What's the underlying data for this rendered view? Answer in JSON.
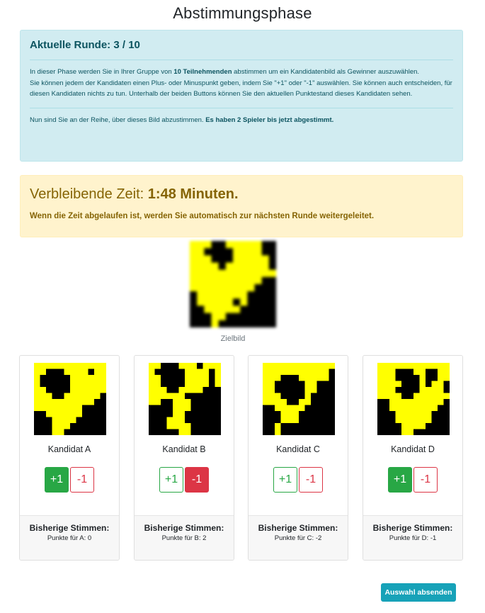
{
  "page": {
    "title": "Abstimmungsphase"
  },
  "info": {
    "round_label": "Aktuelle Runde: 3 / 10",
    "p1_pre": "In dieser Phase werden Sie in Ihrer Gruppe von ",
    "p1_bold": "10 Teilnehmenden",
    "p1_post": " abstimmen um ein Kandidatenbild als Gewinner auszuwählen.",
    "p2": "Sie können jedem der Kandidaten einen Plus- oder Minuspunkt geben, indem Sie \"+1\" oder \"-1\" auswählen. Sie können auch entscheiden, für diesen Kandidaten nichts zu tun. Unterhalb der beiden Buttons können Sie den aktuellen Punktestand dieses Kandidaten sehen.",
    "turn_text": "Nun sind Sie an der Reihe, über dieses Bild abzustimmen. ",
    "turn_bold": "Es haben 2 Spieler bis jetzt abgestimmt."
  },
  "timer": {
    "label": "Verbleibende Zeit: ",
    "value": "1:48 Minuten.",
    "note": "Wenn die Zeit abgelaufen ist, werden Sie automatisch zur nächsten Runde weitergeleitet."
  },
  "target": {
    "caption": "Zielbild"
  },
  "colors": {
    "yellow": "#ffff00",
    "black": "#000000",
    "plus": "#28a745",
    "minus": "#dc3545",
    "info_bg": "#d1ecf1",
    "warn_bg": "#fff3cd",
    "submit": "#17a2b8"
  },
  "candidates": [
    {
      "name": "Kandidat A",
      "plus_label": "+1",
      "minus_label": "-1",
      "selected": "plus",
      "footer_label": "Bisherige Stimmen:",
      "points_text": "Punkte für A: 0"
    },
    {
      "name": "Kandidat B",
      "plus_label": "+1",
      "minus_label": "-1",
      "selected": "minus",
      "footer_label": "Bisherige Stimmen:",
      "points_text": "Punkte für B: 2"
    },
    {
      "name": "Kandidat C",
      "plus_label": "+1",
      "minus_label": "-1",
      "selected": "none",
      "footer_label": "Bisherige Stimmen:",
      "points_text": "Punkte für C: -2"
    },
    {
      "name": "Kandidat D",
      "plus_label": "+1",
      "minus_label": "-1",
      "selected": "plus",
      "footer_label": "Bisherige Stimmen:",
      "points_text": "Punkte für D: -1"
    }
  ],
  "submit": {
    "label": "Auswahl absenden"
  }
}
